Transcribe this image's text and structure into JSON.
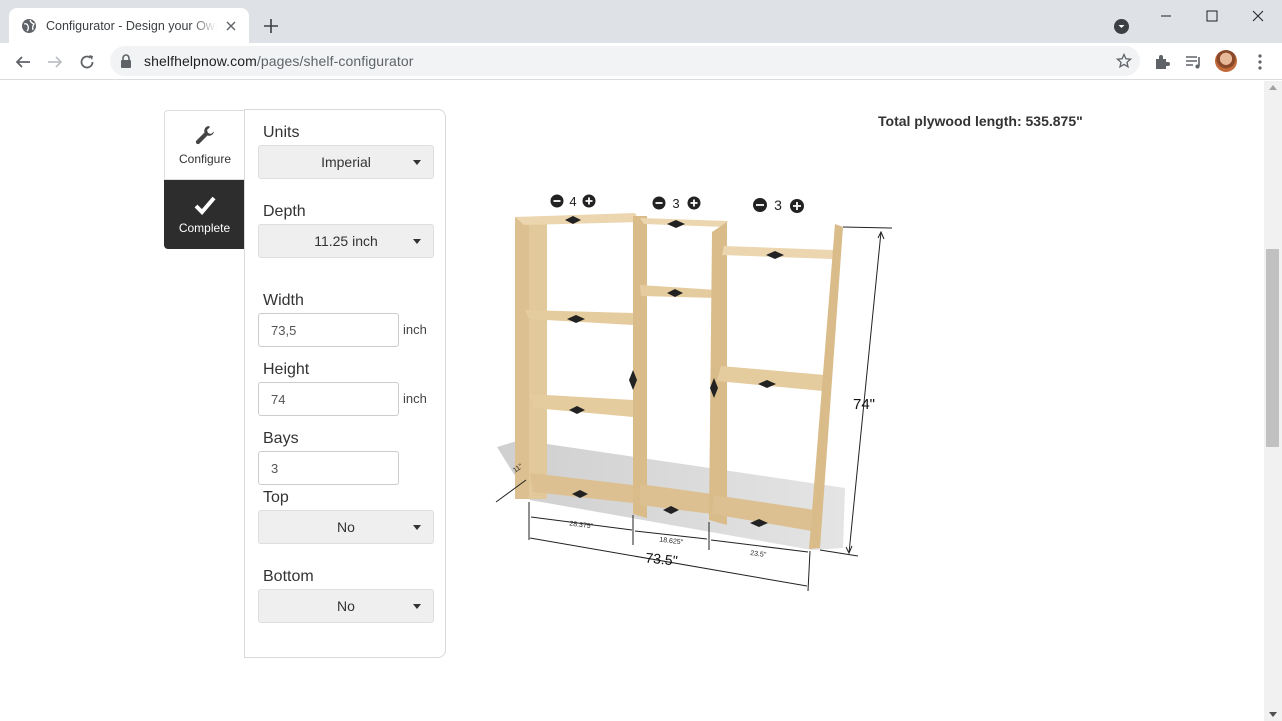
{
  "browser": {
    "tab_title": "Configurator - Design your Own Shelves",
    "url_host": "shelfhelpnow.com",
    "url_path": "/pages/shelf-configurator"
  },
  "sidebar": {
    "configure_label": "Configure",
    "complete_label": "Complete"
  },
  "form": {
    "units_label": "Units",
    "units_value": "Imperial",
    "depth_label": "Depth",
    "depth_value": "11.25 inch",
    "width_label": "Width",
    "width_value": "73,5",
    "width_unit": "inch",
    "height_label": "Height",
    "height_value": "74",
    "height_unit": "inch",
    "bays_label": "Bays",
    "bays_value": "3",
    "top_label": "Top",
    "top_value": "No",
    "bottom_label": "Bottom",
    "bottom_value": "No"
  },
  "summary": {
    "total_plywood": "Total plywood length: 535.875\""
  },
  "preview": {
    "bay_counts": [
      "4",
      "3",
      "3"
    ],
    "total_width": "73.5\"",
    "total_height": "74\"",
    "bay_widths": [
      "28.375\"",
      "18.625\"",
      "23.5\""
    ],
    "depth_dim": "11\""
  },
  "colors": {
    "wood": "#e7cfa4",
    "wood_dark": "#caa978",
    "complete_bg": "#2d2d2d"
  }
}
